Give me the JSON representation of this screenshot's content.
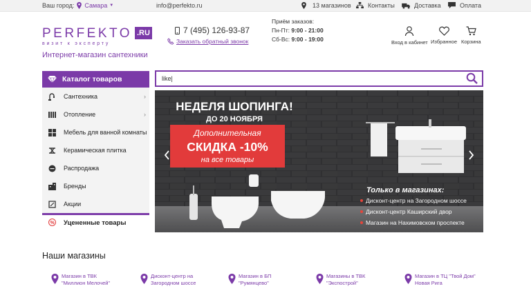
{
  "topbar": {
    "city_label": "Ваш город:",
    "city": "Самара",
    "email": "info@perfekto.ru",
    "stores_count": "13 магазинов",
    "contacts": "Контакты",
    "delivery": "Доставка",
    "payment": "Оплата"
  },
  "logo": {
    "word": "PERFEKTO",
    "ru": ".RU",
    "tagline": "визит к эксперту"
  },
  "subtitle": "Интернет-магазин сантехники",
  "phone": "7 (495) 126-93-87",
  "callback": "Заказать обратный звонок",
  "hours": {
    "title": "Приём заказов:",
    "weekday_label": "Пн-Пт:",
    "weekday_time": "9:00 - 21:00",
    "weekend_label": "Сб-Вс:",
    "weekend_time": "9:00 - 19:00"
  },
  "header_actions": {
    "account": "Вход в кабинет",
    "favorites": "Избранное",
    "cart": "Корзина"
  },
  "catalog": {
    "title": "Каталог товаров",
    "items": [
      {
        "label": "Сантехника",
        "icon": "faucet-icon",
        "has_sub": true
      },
      {
        "label": "Отопление",
        "icon": "radiator-icon",
        "has_sub": true
      },
      {
        "label": "Мебель для ванной комнаты",
        "icon": "cabinet-icon",
        "has_sub": false
      },
      {
        "label": "Керамическая плитка",
        "icon": "tile-icon",
        "has_sub": false
      },
      {
        "label": "Распродажа",
        "icon": "sale-icon",
        "has_sub": false
      },
      {
        "label": "Бренды",
        "icon": "brands-icon",
        "has_sub": false
      },
      {
        "label": "Акции",
        "icon": "promo-icon",
        "has_sub": false
      }
    ],
    "discounted": "Уцененные товары"
  },
  "search": {
    "value": "like|"
  },
  "banner": {
    "headline": "НЕДЕЛЯ ШОПИНГА!",
    "until": "ДО 20 НОЯБРЯ",
    "promo_line1": "Дополнительная",
    "promo_line2": "СКИДКА -10%",
    "promo_line3": "на все товары",
    "stores_title": "Только в магазинах:",
    "stores": [
      "Дисконт-центр на Загородном шоссе",
      "Дисконт-центр Каширский двор",
      "Магазин на Нахимовском проспекте"
    ]
  },
  "our_stores": {
    "title": "Наши магазины",
    "items": [
      {
        "line1": "Магазин в ТВК",
        "line2": "\"Миллион Мелочей\""
      },
      {
        "line1": "Дисконт-центр на",
        "line2": "Загородном шоссе"
      },
      {
        "line1": "Магазин в БП",
        "line2": "\"Румянцево\""
      },
      {
        "line1": "Магазины в ТВК",
        "line2": "\"Экспострой\""
      },
      {
        "line1": "Магазин в ТЦ \"Твой Дом\"",
        "line2": "Новая Рига"
      }
    ]
  },
  "colors": {
    "brand": "#7b3aa8",
    "promo_red": "#e23b3b",
    "bullet": "#e8443a"
  }
}
